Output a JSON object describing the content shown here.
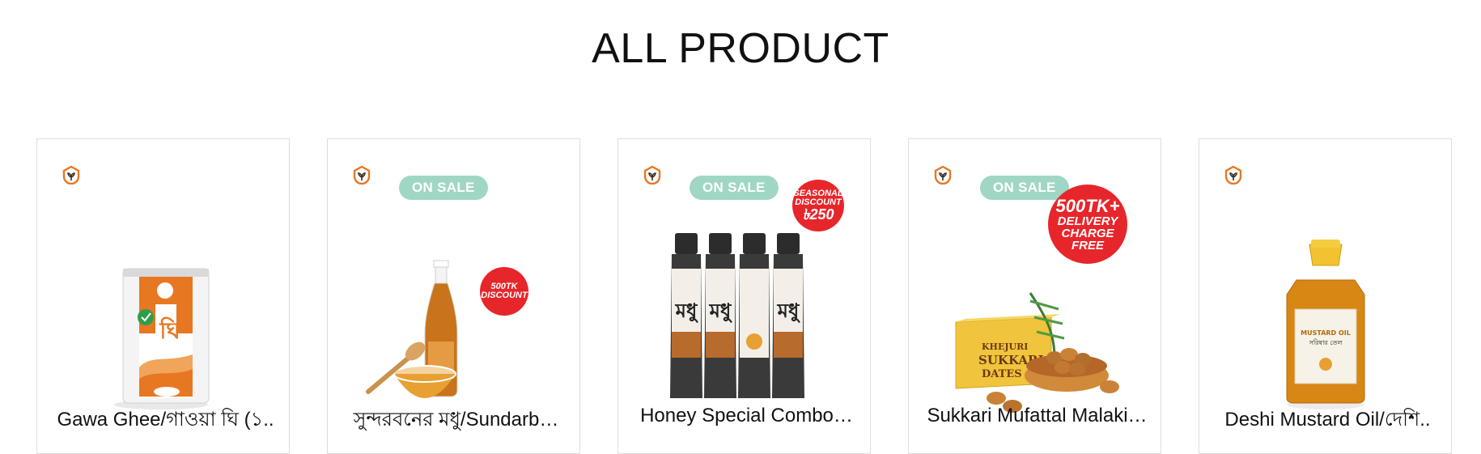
{
  "section": {
    "title": "ALL PRODUCT"
  },
  "colors": {
    "accent_orange": "#e87722",
    "sale_badge": "#9fd7c4",
    "promo_red": "#e7262b"
  },
  "products": [
    {
      "name": "Gawa Ghee/গাওয়া ঘি (১..",
      "on_sale": false,
      "icon": "brand-logo-icon"
    },
    {
      "name": "সুন্দরবনের মধু/Sundarb…",
      "on_sale": true,
      "sale_label": "ON SALE",
      "promo_lines": [
        "500TK",
        "DISCOUNT"
      ],
      "icon": "brand-logo-icon"
    },
    {
      "name": "Honey Special Combo…",
      "on_sale": true,
      "sale_label": "ON SALE",
      "promo_lines": [
        "SEASONAL",
        "DISCOUNT",
        "৳250"
      ],
      "icon": "brand-logo-icon"
    },
    {
      "name": "Sukkari Mufattal Malaki…",
      "on_sale": true,
      "sale_label": "ON SALE",
      "promo_lines": [
        "500TK+",
        "DELIVERY",
        "CHARGE FREE"
      ],
      "icon": "brand-logo-icon",
      "package_lines": [
        "KHEJURI",
        "SUKKARI",
        "DATES"
      ]
    },
    {
      "name": "Deshi Mustard Oil/দেশি..",
      "on_sale": false,
      "icon": "brand-logo-icon",
      "label_lines": [
        "MUSTARD OIL",
        "সরিষার তেল"
      ]
    }
  ]
}
